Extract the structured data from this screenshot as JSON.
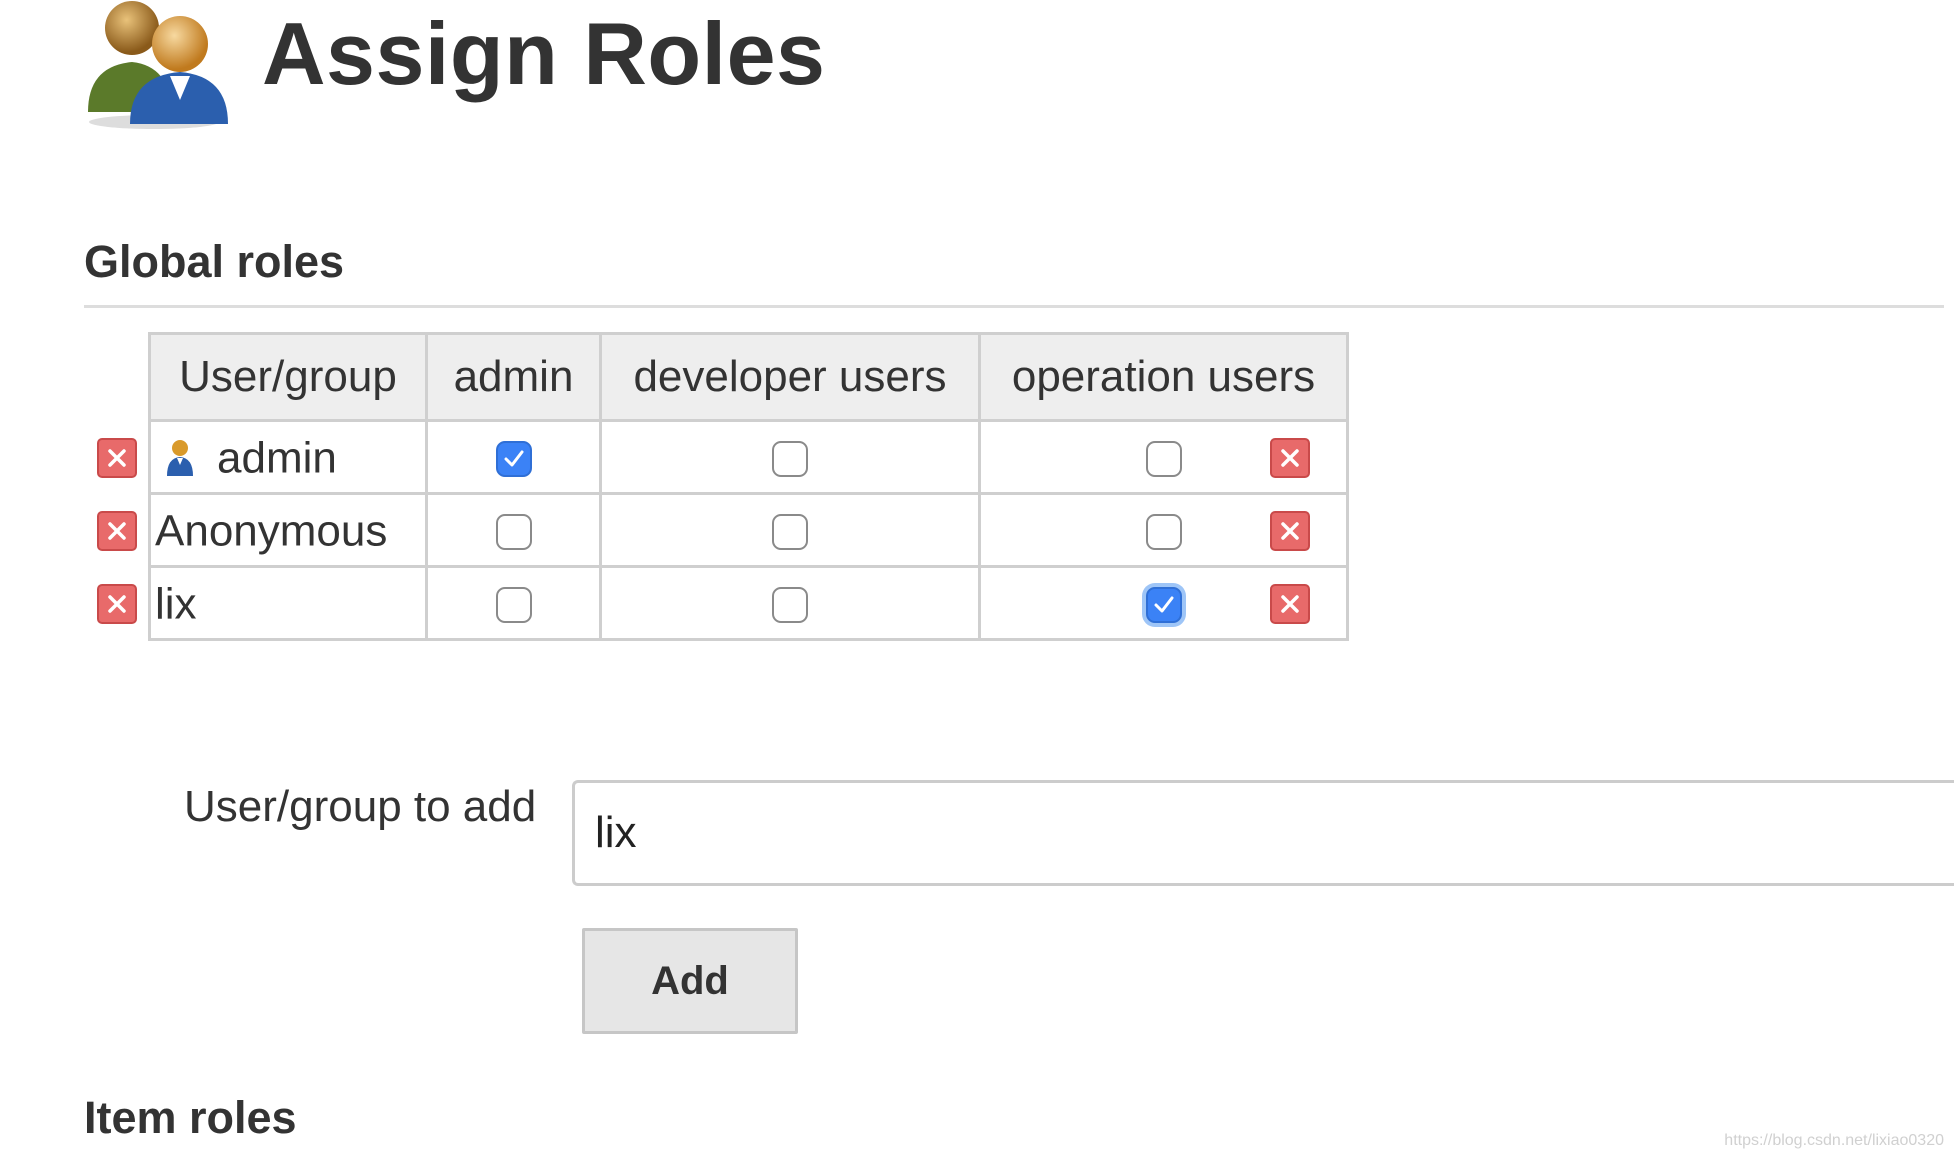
{
  "page": {
    "title": "Assign Roles",
    "icon": "users-group-icon"
  },
  "global_roles": {
    "title": "Global roles",
    "columns": [
      "User/group",
      "admin",
      "developer users",
      "operation users"
    ],
    "rows": [
      {
        "user": "admin",
        "has_user_icon": true,
        "admin": true,
        "developer_users": false,
        "operation_users": false
      },
      {
        "user": "Anonymous",
        "has_user_icon": false,
        "admin": false,
        "developer_users": false,
        "operation_users": false
      },
      {
        "user": "lix",
        "has_user_icon": false,
        "admin": false,
        "developer_users": false,
        "operation_users": true
      }
    ]
  },
  "add_form": {
    "label": "User/group to add",
    "input_value": "lix",
    "button_label": "Add"
  },
  "item_roles": {
    "title": "Item roles"
  },
  "watermark": "https://blog.csdn.net/lixiao0320",
  "colors": {
    "checkbox_checked": "#3b82f6",
    "delete_icon": "#e05555",
    "header_bg": "#eeeeee"
  }
}
